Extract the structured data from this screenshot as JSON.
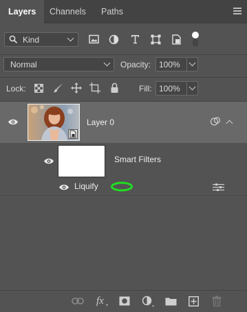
{
  "tabs": [
    {
      "label": "Layers",
      "active": true
    },
    {
      "label": "Channels",
      "active": false
    },
    {
      "label": "Paths",
      "active": false
    }
  ],
  "filter": {
    "kind_label": "Kind",
    "icons": [
      "image-filter-icon",
      "adjustment-filter-icon",
      "type-filter-icon",
      "shape-filter-icon",
      "smart-object-filter-icon",
      "filter-toggle-icon"
    ]
  },
  "blend": {
    "mode": "Normal",
    "opacity_label": "Opacity:",
    "opacity_value": "100%"
  },
  "lock": {
    "label": "Lock:",
    "icons": [
      "lock-transparent-icon",
      "lock-image-icon",
      "lock-position-icon",
      "lock-artboard-icon",
      "lock-all-icon"
    ],
    "fill_label": "Fill:",
    "fill_value": "100%"
  },
  "layers": {
    "layer_name": "Layer 0",
    "smart_filters_label": "Smart Filters",
    "filter_name": "Liquify"
  },
  "colors": {
    "panel_bg": "#535353",
    "selected_row": "#696969",
    "highlight_ellipse": "#22dd22"
  },
  "bottom_icons": [
    "link-layers-icon",
    "fx-icon",
    "add-mask-icon",
    "adjustment-layer-icon",
    "new-group-icon",
    "new-layer-icon",
    "delete-layer-icon"
  ]
}
